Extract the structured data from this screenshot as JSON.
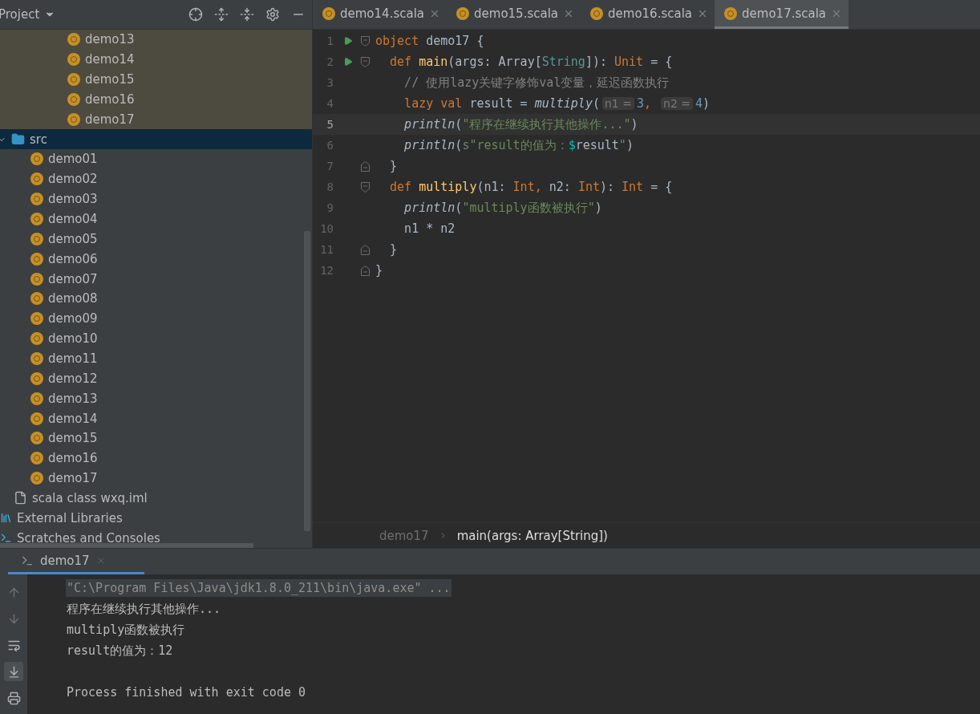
{
  "project_panel": {
    "title": "Project",
    "scrolled_items": [
      {
        "label": "demo13",
        "kind": "object"
      },
      {
        "label": "demo14",
        "kind": "object"
      },
      {
        "label": "demo15",
        "kind": "object"
      },
      {
        "label": "demo16",
        "kind": "object"
      },
      {
        "label": "demo17",
        "kind": "object"
      }
    ],
    "items": [
      {
        "label": "src",
        "kind": "folder",
        "expanded": true,
        "selected": true,
        "children": [
          {
            "label": "demo01",
            "kind": "object"
          },
          {
            "label": "demo02",
            "kind": "object"
          },
          {
            "label": "demo03",
            "kind": "object"
          },
          {
            "label": "demo04",
            "kind": "object"
          },
          {
            "label": "demo05",
            "kind": "object"
          },
          {
            "label": "demo06",
            "kind": "object"
          },
          {
            "label": "demo07",
            "kind": "object"
          },
          {
            "label": "demo08",
            "kind": "object"
          },
          {
            "label": "demo09",
            "kind": "object"
          },
          {
            "label": "demo10",
            "kind": "object"
          },
          {
            "label": "demo11",
            "kind": "object"
          },
          {
            "label": "demo12",
            "kind": "object"
          },
          {
            "label": "demo13",
            "kind": "object"
          },
          {
            "label": "demo14",
            "kind": "object"
          },
          {
            "label": "demo15",
            "kind": "object"
          },
          {
            "label": "demo16",
            "kind": "object"
          },
          {
            "label": "demo17",
            "kind": "object"
          }
        ]
      },
      {
        "label": "scala class wxq.iml",
        "kind": "file"
      },
      {
        "label": "External Libraries",
        "kind": "libraries"
      },
      {
        "label": "Scratches and Consoles",
        "kind": "scratches"
      }
    ]
  },
  "editor": {
    "tabs": [
      {
        "label": "demo14.scala",
        "selected": false
      },
      {
        "label": "demo15.scala",
        "selected": false
      },
      {
        "label": "demo16.scala",
        "selected": false
      },
      {
        "label": "demo17.scala",
        "selected": true
      }
    ],
    "lines": [
      {
        "number": "1",
        "run": true,
        "fold_start": true,
        "fold_end": false,
        "current": false,
        "tokens": [
          {
            "kind": "kw",
            "text": "object "
          },
          {
            "kind": "plain",
            "text": "demo17 {"
          }
        ]
      },
      {
        "number": "2",
        "run": true,
        "fold_start": true,
        "fold_end": false,
        "current": false,
        "tokens": [
          {
            "kind": "kw",
            "text": "  def "
          },
          {
            "kind": "decl",
            "text": "main"
          },
          {
            "kind": "plain",
            "text": "(args: Array["
          },
          {
            "kind": "type",
            "text": "String"
          },
          {
            "kind": "plain",
            "text": "]): "
          },
          {
            "kind": "kw",
            "text": "Unit"
          },
          {
            "kind": "plain",
            "text": " = {"
          }
        ]
      },
      {
        "number": "3",
        "run": false,
        "fold_start": false,
        "fold_end": false,
        "current": false,
        "tokens": [
          {
            "kind": "comment",
            "text": "    // 使用lazy关键字修饰val变量，延迟函数执行"
          }
        ]
      },
      {
        "number": "4",
        "run": false,
        "fold_start": false,
        "fold_end": false,
        "current": false,
        "tokens": [
          {
            "kind": "kw",
            "text": "    lazy val "
          },
          {
            "kind": "plain",
            "text": "result = "
          },
          {
            "kind": "call",
            "text": "multiply"
          },
          {
            "kind": "plain",
            "text": "("
          },
          {
            "kind": "hint",
            "text": "n1 ="
          },
          {
            "kind": "num",
            "text": "3"
          },
          {
            "kind": "kw",
            "text": ", "
          },
          {
            "kind": "hint",
            "text": "n2 ="
          },
          {
            "kind": "num",
            "text": "4"
          },
          {
            "kind": "plain",
            "text": ")"
          }
        ]
      },
      {
        "number": "5",
        "run": false,
        "fold_start": false,
        "fold_end": false,
        "current": true,
        "tokens": [
          {
            "kind": "call",
            "text": "    println"
          },
          {
            "kind": "plain",
            "text": "("
          },
          {
            "kind": "str",
            "text": "\"程序在继续执行其他操作...\""
          },
          {
            "kind": "plain",
            "text": ")"
          }
        ]
      },
      {
        "number": "6",
        "run": false,
        "fold_start": false,
        "fold_end": false,
        "current": false,
        "tokens": [
          {
            "kind": "call",
            "text": "    println"
          },
          {
            "kind": "plain",
            "text": "("
          },
          {
            "kind": "str",
            "text": "s\"result的值为："
          },
          {
            "kind": "interp",
            "text": "$"
          },
          {
            "kind": "plain",
            "text": "result"
          },
          {
            "kind": "str",
            "text": "\""
          },
          {
            "kind": "plain",
            "text": ")"
          }
        ]
      },
      {
        "number": "7",
        "run": false,
        "fold_start": false,
        "fold_end": true,
        "current": false,
        "tokens": [
          {
            "kind": "plain",
            "text": "  }"
          }
        ]
      },
      {
        "number": "8",
        "run": false,
        "fold_start": true,
        "fold_end": false,
        "current": false,
        "tokens": [
          {
            "kind": "kw",
            "text": "  def "
          },
          {
            "kind": "decl",
            "text": "multiply"
          },
          {
            "kind": "plain",
            "text": "(n1: "
          },
          {
            "kind": "kw",
            "text": "Int, "
          },
          {
            "kind": "plain",
            "text": "n2: "
          },
          {
            "kind": "kw",
            "text": "Int"
          },
          {
            "kind": "plain",
            "text": "): "
          },
          {
            "kind": "kw",
            "text": "Int"
          },
          {
            "kind": "plain",
            "text": " = {"
          }
        ]
      },
      {
        "number": "9",
        "run": false,
        "fold_start": false,
        "fold_end": false,
        "current": false,
        "tokens": [
          {
            "kind": "call",
            "text": "    println"
          },
          {
            "kind": "plain",
            "text": "("
          },
          {
            "kind": "str",
            "text": "\"multiply函数被执行\""
          },
          {
            "kind": "plain",
            "text": ")"
          }
        ]
      },
      {
        "number": "10",
        "run": false,
        "fold_start": false,
        "fold_end": false,
        "current": false,
        "tokens": [
          {
            "kind": "plain",
            "text": "    n1 * n2"
          }
        ]
      },
      {
        "number": "11",
        "run": false,
        "fold_start": false,
        "fold_end": true,
        "current": false,
        "tokens": [
          {
            "kind": "plain",
            "text": "  }"
          }
        ]
      },
      {
        "number": "12",
        "run": false,
        "fold_start": false,
        "fold_end": true,
        "current": false,
        "tokens": [
          {
            "kind": "plain",
            "text": "}"
          }
        ]
      }
    ],
    "breadcrumbs": [
      "demo17",
      "main(args: Array[String])"
    ]
  },
  "run_panel": {
    "tab": {
      "label": "demo17",
      "selected": true
    },
    "lines": [
      {
        "kind": "command",
        "text": "\"C:\\Program Files\\Java\\jdk1.8.0_211\\bin\\java.exe\" ..."
      },
      {
        "kind": "output",
        "text": "程序在继续执行其他操作..."
      },
      {
        "kind": "output",
        "text": "multiply函数被执行"
      },
      {
        "kind": "output",
        "text": "result的值为：12"
      },
      {
        "kind": "exit",
        "text": "Process finished with exit code 0"
      }
    ]
  }
}
